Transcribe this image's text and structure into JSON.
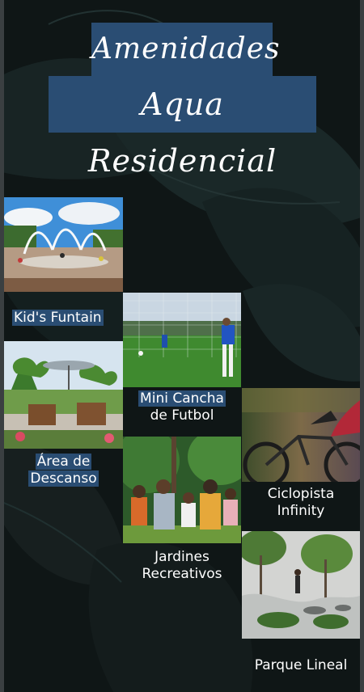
{
  "header": {
    "title_line1": "Amenidades",
    "title_line2": "Aqua Residencial"
  },
  "amenities": [
    {
      "name": "Kid's Funtain"
    },
    {
      "name_line1": "Mini Cancha",
      "name_line2": "de Futbol"
    },
    {
      "name_line1": "Área de",
      "name_line2": "Descanso"
    },
    {
      "name_line1": "Ciclopista",
      "name_line2": "Infinity"
    },
    {
      "name_line1": "Jardines",
      "name_line2": "Recreativos"
    },
    {
      "name": "Parque Lineal"
    }
  ],
  "colors": {
    "accent": "#2a4d73",
    "background": "#0d1313"
  }
}
